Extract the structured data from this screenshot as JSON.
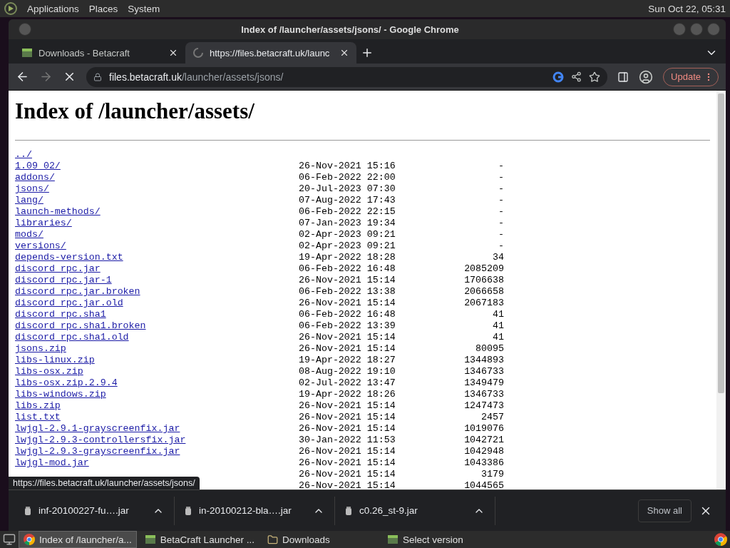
{
  "panel": {
    "menus": [
      "Applications",
      "Places",
      "System"
    ],
    "clock": "Sun Oct 22, 05:31"
  },
  "window": {
    "title": "Index of /launcher/assets/jsons/ - Google Chrome"
  },
  "tabs": [
    {
      "title": "Downloads - Betacraft",
      "selected": false,
      "loading": false
    },
    {
      "title": "https://files.betacraft.uk/launc",
      "selected": true,
      "loading": true
    }
  ],
  "toolbar": {
    "url_host": "files.betacraft.uk",
    "url_path": "/launcher/assets/jsons/",
    "update_label": "Update"
  },
  "page": {
    "heading": "Index of /launcher/assets/",
    "entries": [
      {
        "name": "../"
      },
      {
        "name": "1.09_02/",
        "date": "26-Nov-2021 15:16",
        "size": "-"
      },
      {
        "name": "addons/",
        "date": "06-Feb-2022 22:00",
        "size": "-"
      },
      {
        "name": "jsons/",
        "date": "20-Jul-2023 07:30",
        "size": "-"
      },
      {
        "name": "lang/",
        "date": "07-Aug-2022 17:43",
        "size": "-"
      },
      {
        "name": "launch-methods/",
        "date": "06-Feb-2022 22:15",
        "size": "-"
      },
      {
        "name": "libraries/",
        "date": "07-Jan-2023 19:34",
        "size": "-"
      },
      {
        "name": "mods/",
        "date": "02-Apr-2023 09:21",
        "size": "-"
      },
      {
        "name": "versions/",
        "date": "02-Apr-2023 09:21",
        "size": "-"
      },
      {
        "name": "depends-version.txt",
        "date": "19-Apr-2022 18:28",
        "size": "34"
      },
      {
        "name": "discord_rpc.jar",
        "date": "06-Feb-2022 16:48",
        "size": "2085209"
      },
      {
        "name": "discord_rpc.jar-1",
        "date": "26-Nov-2021 15:14",
        "size": "1706638"
      },
      {
        "name": "discord_rpc.jar.broken",
        "date": "06-Feb-2022 13:38",
        "size": "2066658"
      },
      {
        "name": "discord_rpc.jar.old",
        "date": "26-Nov-2021 15:14",
        "size": "2067183"
      },
      {
        "name": "discord_rpc.sha1",
        "date": "06-Feb-2022 16:48",
        "size": "41"
      },
      {
        "name": "discord_rpc.sha1.broken",
        "date": "06-Feb-2022 13:39",
        "size": "41"
      },
      {
        "name": "discord_rpc.sha1.old",
        "date": "26-Nov-2021 15:14",
        "size": "41"
      },
      {
        "name": "jsons.zip",
        "date": "26-Nov-2021 15:14",
        "size": "80095"
      },
      {
        "name": "libs-linux.zip",
        "date": "19-Apr-2022 18:27",
        "size": "1344893"
      },
      {
        "name": "libs-osx.zip",
        "date": "08-Aug-2022 19:10",
        "size": "1346733"
      },
      {
        "name": "libs-osx.zip.2.9.4",
        "date": "02-Jul-2022 13:47",
        "size": "1349479"
      },
      {
        "name": "libs-windows.zip",
        "date": "19-Apr-2022 18:26",
        "size": "1346733"
      },
      {
        "name": "libs.zip",
        "date": "26-Nov-2021 15:14",
        "size": "1247473"
      },
      {
        "name": "list.txt",
        "date": "26-Nov-2021 15:14",
        "size": "2457"
      },
      {
        "name": "lwjgl-2.9.1-grayscreenfix.jar",
        "date": "26-Nov-2021 15:14",
        "size": "1019076"
      },
      {
        "name": "lwjgl-2.9.3-controllersfix.jar",
        "date": "30-Jan-2022 11:53",
        "size": "1042721"
      },
      {
        "name": "lwjgl-2.9.3-grayscreenfix.jar",
        "date": "26-Nov-2021 15:14",
        "size": "1042948"
      },
      {
        "name": "lwjgl-mod.jar",
        "date": "26-Nov-2021 15:14",
        "size": "1043386"
      },
      {
        "date": "26-Nov-2021 15:14",
        "size": "3179"
      },
      {
        "date": "26-Nov-2021 15:14",
        "size": "1044565"
      }
    ]
  },
  "status_bubble": "https://files.betacraft.uk/launcher/assets/jsons/",
  "downloads": [
    {
      "filename": "inf-20100227-fu….jar"
    },
    {
      "filename": "in-20100212-bla….jar"
    },
    {
      "filename": "c0.26_st-9.jar"
    }
  ],
  "show_all": "Show all",
  "taskbar": [
    {
      "kind": "browser",
      "label": "Index of /launcher/a...",
      "selected": true
    },
    {
      "kind": "app",
      "label": "BetaCraft Launcher ...",
      "selected": false
    },
    {
      "kind": "folder",
      "label": "Downloads",
      "selected": false
    },
    {
      "kind": "app",
      "label": "Select version",
      "selected": false
    }
  ]
}
